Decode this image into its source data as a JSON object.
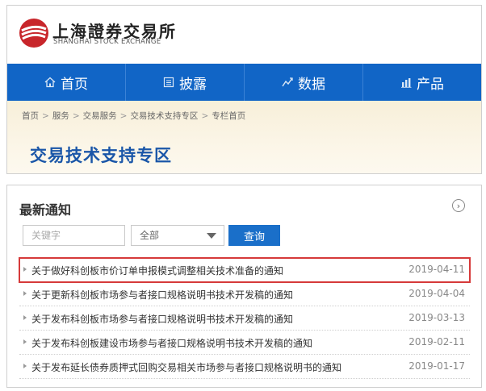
{
  "header": {
    "logo_cn": "上海證券交易所",
    "logo_en": "SHANGHAI STOCK EXCHANGE"
  },
  "nav": [
    {
      "label": "首页",
      "icon": "home-icon"
    },
    {
      "label": "披露",
      "icon": "document-icon"
    },
    {
      "label": "数据",
      "icon": "trend-icon"
    },
    {
      "label": "产品",
      "icon": "bar-chart-icon"
    }
  ],
  "breadcrumb": [
    "首页",
    "服务",
    "交易服务",
    "交易技术支持专区",
    "专栏首页"
  ],
  "breadcrumb_separator": ">",
  "banner_title": "交易技术支持专区",
  "notices": {
    "title": "最新通知",
    "search_placeholder": "关键字",
    "select_value": "全部",
    "query_label": "查询",
    "items": [
      {
        "title": "关于做好科创板市价订单申报模式调整相关技术准备的通知",
        "date": "2019-04-11",
        "highlighted": true
      },
      {
        "title": "关于更新科创板市场参与者接口规格说明书技术开发稿的通知",
        "date": "2019-04-04",
        "highlighted": false
      },
      {
        "title": "关于发布科创板市场参与者接口规格说明书技术开发稿的通知",
        "date": "2019-03-13",
        "highlighted": false
      },
      {
        "title": "关于发布科创板建设市场参与者接口规格说明书技术开发稿的通知",
        "date": "2019-02-11",
        "highlighted": false
      },
      {
        "title": "关于发布延长债券质押式回购交易相关市场参与者接口规格说明书的通知",
        "date": "2019-01-17",
        "highlighted": false
      }
    ]
  },
  "colors": {
    "nav_bg": "#1165c6",
    "title_blue": "#1a56a8",
    "button_blue": "#1a6fc9",
    "highlight_red": "#d63a3a",
    "logo_red": "#c8262b"
  }
}
